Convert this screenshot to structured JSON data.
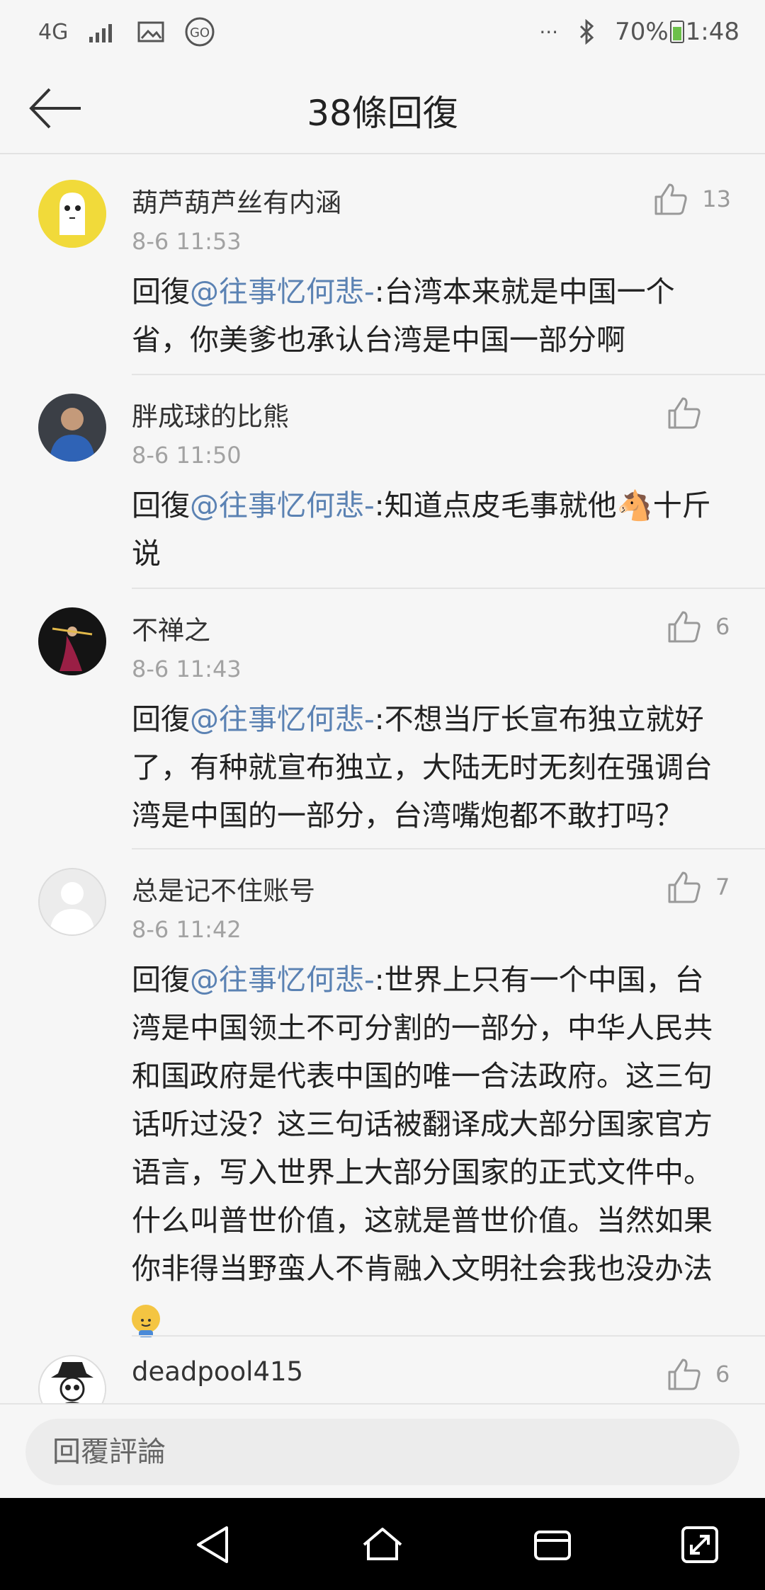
{
  "status_bar": {
    "network": "4G",
    "battery": "70%",
    "time": "1:48",
    "overflow": "···"
  },
  "header": {
    "title": "38條回復",
    "back_icon": "arrow-left-icon"
  },
  "reply_prefix": "回復",
  "comments": [
    {
      "author": "葫芦葫芦丝有内涵",
      "time": "8-6 11:53",
      "likes": "13",
      "mention": "@往事忆何悲-",
      "text": ":台湾本来就是中国一个省，你美爹也承认台湾是中国一部分啊"
    },
    {
      "author": "胖成球的比熊",
      "time": "8-6 11:50",
      "likes": "",
      "mention": "@往事忆何悲-",
      "text_before": ":知道点皮毛事就他",
      "emoji": "🐴",
      "text_after": "十斤说"
    },
    {
      "author": "不禅之",
      "time": "8-6 11:43",
      "likes": "6",
      "mention": "@往事忆何悲-",
      "text": ":不想当厅长宣布独立就好了，有种就宣布独立，大陆无时无刻在强调台湾是中国的一部分，台湾嘴炮都不敢打吗？"
    },
    {
      "author": "总是记不住账号",
      "time": "8-6 11:42",
      "likes": "7",
      "mention": "@往事忆何悲-",
      "text": ":世界上只有一个中国，台湾是中国领土不可分割的一部分，中华人民共和国政府是代表中国的唯一合法政府。这三句话听过没？这三句话被翻译成大部分国家官方语言，写入世界上大部分国家的正式文件中。什么叫普世价值，这就是普世价值。当然如果你非得当野蛮人不肯融入文明社会我也没办法"
    },
    {
      "author": "deadpool415",
      "time": "",
      "likes": "6",
      "mention": "",
      "text": ""
    }
  ],
  "input": {
    "placeholder": "回覆評論"
  },
  "colors": {
    "mention": "#5b82b3",
    "background": "#f6f6f6",
    "nav_bar": "#000000"
  }
}
